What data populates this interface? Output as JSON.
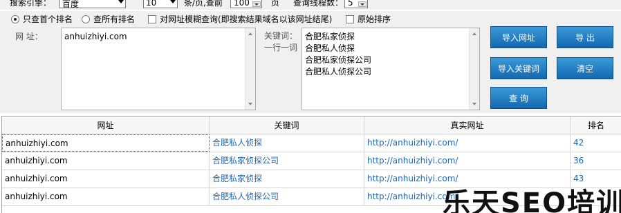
{
  "top": {
    "engine_label": "搜索引擎：",
    "engine_value": "百度",
    "per_page_value": "10",
    "per_page_label": "条/页,查前",
    "pages_value": "100",
    "pages_unit": "页",
    "threads_label": "查询线程数：",
    "threads_value": "5"
  },
  "options": {
    "first_rank": "只查首个排名",
    "all_rank": "查所有排名",
    "fuzzy": "对网址模糊查询(即搜索结果域名以该网址结尾)",
    "raw_sort": "原始排序"
  },
  "form": {
    "url_label": "网   址：",
    "url_value": "anhuizhiyi.com",
    "kw_label_1": "关键词：",
    "kw_label_2": "一行一词",
    "keywords": [
      "合肥私家侦探",
      "合肥私人侦探",
      "合肥私家侦探公司",
      "合肥私人侦探公司"
    ]
  },
  "buttons": {
    "import_url": "导入网址",
    "export": "导  出",
    "import_kw": "导入关键词",
    "clear": "清空",
    "query": "查  询"
  },
  "table": {
    "headers": [
      "网址",
      "关键词",
      "真实网址",
      "排名"
    ],
    "rows": [
      [
        "anhuizhiyi.com",
        "合肥私人侦探",
        "http://anhuizhiyi.com/",
        "42"
      ],
      [
        "anhuizhiyi.com",
        "合肥私家侦探公司",
        "http://anhuizhiyi.com/",
        "36"
      ],
      [
        "anhuizhiyi.com",
        "合肥私家侦探",
        "http://anhuizhiyi.com/",
        "43"
      ],
      [
        "anhuizhiyi.com",
        "合肥私人侦探公司",
        "http://anhuizhiyi.com/",
        ""
      ]
    ]
  },
  "watermark": "乐天SEO培训"
}
